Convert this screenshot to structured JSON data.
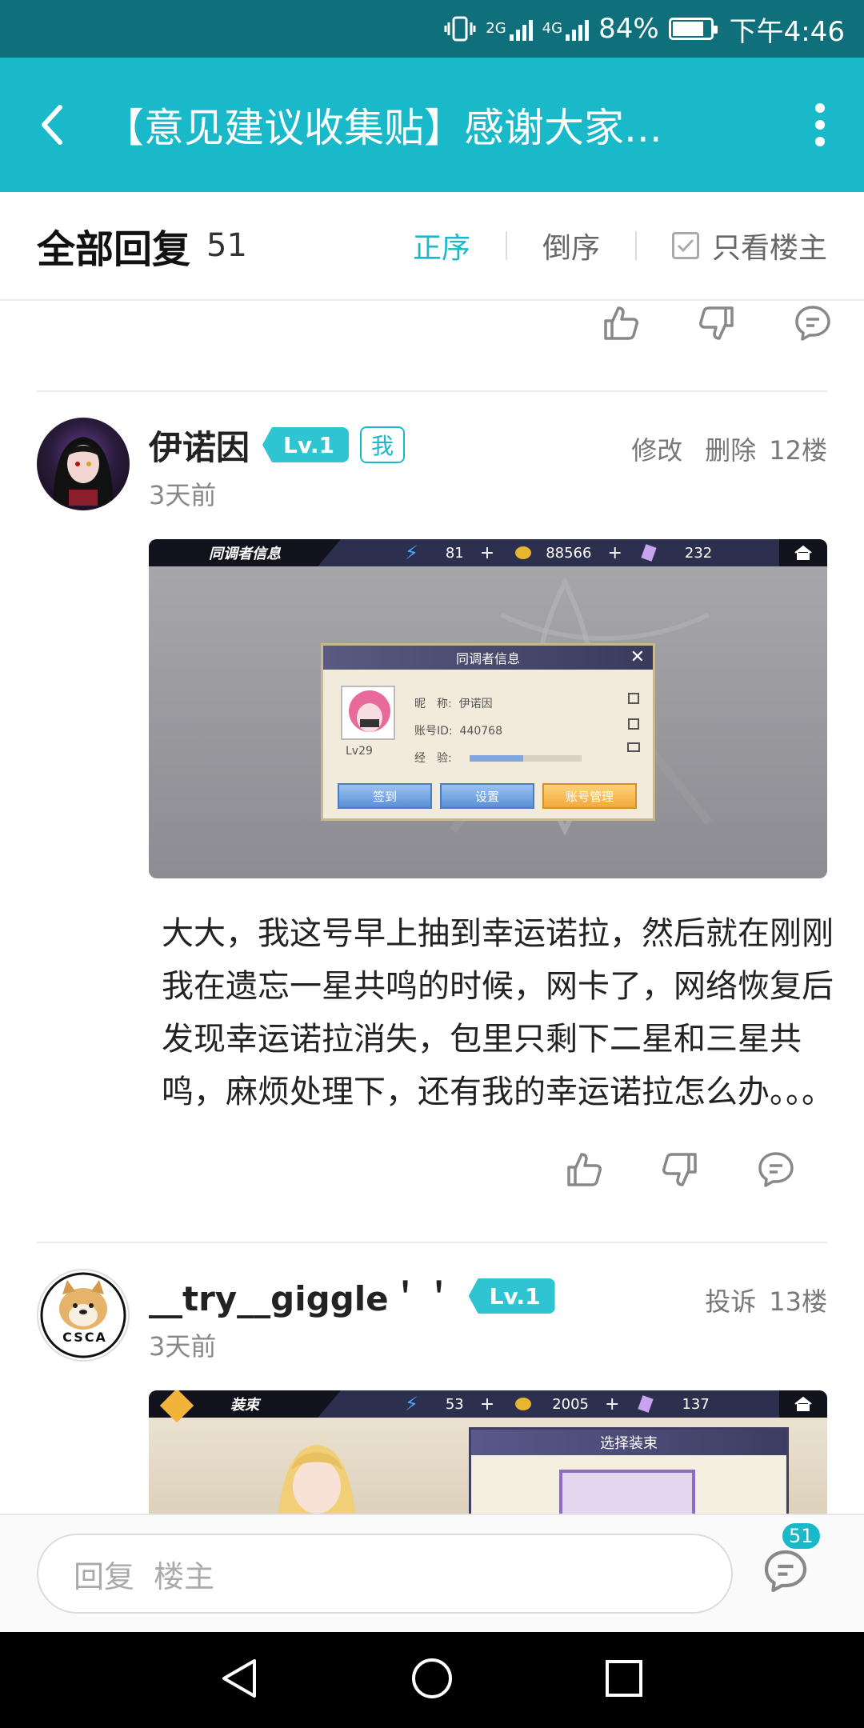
{
  "status_bar": {
    "net_2g": "2G",
    "net_4g": "4G",
    "battery_percent": "84%",
    "battery_level": 0.84,
    "time": "下午4:46"
  },
  "header": {
    "title": "【意见建议收集贴】感谢大家..."
  },
  "filter": {
    "all_replies": "全部回复",
    "count": "51",
    "asc": "正序",
    "desc": "倒序",
    "op_only": "只看楼主"
  },
  "posts": [
    {
      "username": "伊诺因",
      "level": "Lv.1",
      "me_badge": "我",
      "edit": "修改",
      "delete": "删除",
      "floor": "12楼",
      "time": "3天前",
      "shot": {
        "title": "同调者信息",
        "stamina": "81",
        "coins": "88566",
        "gems": "232",
        "dialog_title": "同调者信息",
        "nick_label": "昵　称:",
        "nick_value": "伊诺因",
        "id_label": "账号ID:",
        "id_value": "440768",
        "exp_label": "经　验:",
        "exp_level": 0.48,
        "lv": "Lv29",
        "btn_checkin": "签到",
        "btn_settings": "设置",
        "btn_account": "账号管理"
      },
      "text": "大大，我这号早上抽到幸运诺拉，然后就在刚刚我在遗忘一星共鸣的时候，网卡了，网络恢复后发现幸运诺拉消失，包里只剩下二星和三星共鸣，麻烦处理下，还有我的幸运诺拉怎么办。。。"
    },
    {
      "username": "__try__giggle＇＇",
      "level": "Lv.1",
      "report": "投诉",
      "floor": "13楼",
      "time": "3天前",
      "avatar_text": "CSCA",
      "shot": {
        "title": "装束",
        "stamina": "53",
        "coins": "2005",
        "gems": "137",
        "panel_title": "选择装束"
      }
    }
  ],
  "reply_bar": {
    "placeholder": "回复  楼主",
    "badge": "51"
  },
  "colors": {
    "accent": "#1ab9c9",
    "status_bar": "#0f6f7a"
  }
}
